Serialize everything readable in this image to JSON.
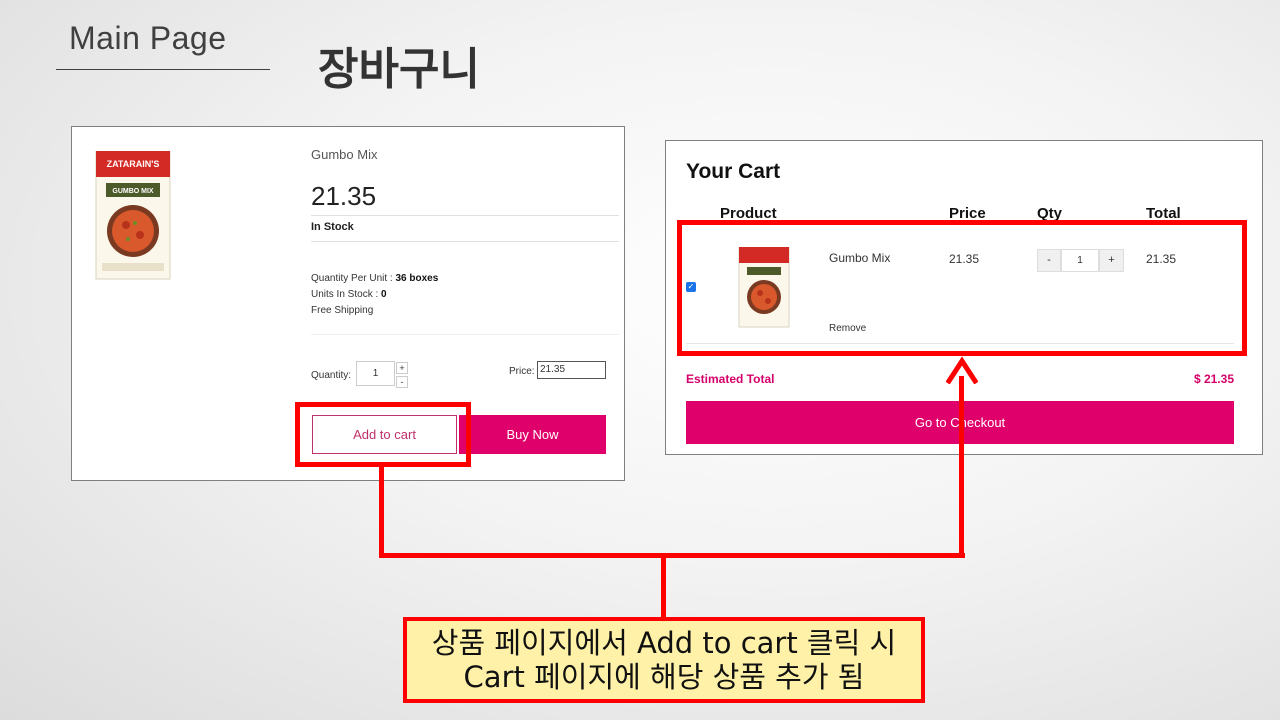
{
  "slide": {
    "main_page_label": "Main Page",
    "title": "장바구니"
  },
  "product_page": {
    "name": "Gumbo Mix",
    "price": "21.35",
    "stock_status": "In Stock",
    "details": [
      {
        "label": "Quantity Per Unit : ",
        "value": "36 boxes"
      },
      {
        "label": "Units In Stock : ",
        "value": "0"
      },
      {
        "label": "Free Shipping",
        "value": ""
      }
    ],
    "quantity_label": "Quantity:",
    "quantity_value": "1",
    "step_up": "+",
    "step_down": "-",
    "price_label": "Price:",
    "price_value": "21.35",
    "add_to_cart_label": "Add to cart",
    "buy_now_label": "Buy Now",
    "box_brand": "ZATARAIN'S",
    "box_product": "GUMBO MIX"
  },
  "cart": {
    "title": "Your Cart",
    "headers": {
      "product": "Product",
      "price": "Price",
      "qty": "Qty",
      "total": "Total"
    },
    "item": {
      "checked": true,
      "name": "Gumbo Mix",
      "remove_label": "Remove",
      "price": "21.35",
      "qty": "1",
      "minus": "-",
      "plus": "+",
      "total": "21.35"
    },
    "estimated_total_label": "Estimated Total",
    "estimated_total_value": "$ 21.35",
    "checkout_label": "Go to Checkout"
  },
  "annotation": {
    "line1": "상품 페이지에서 Add to cart 클릭 시",
    "line2": "Cart 페이지에 해당 상품 추가 됨"
  },
  "colors": {
    "accent": "#e0006b",
    "annotation_red": "#ff0000",
    "note_fill": "#fff2a8"
  }
}
